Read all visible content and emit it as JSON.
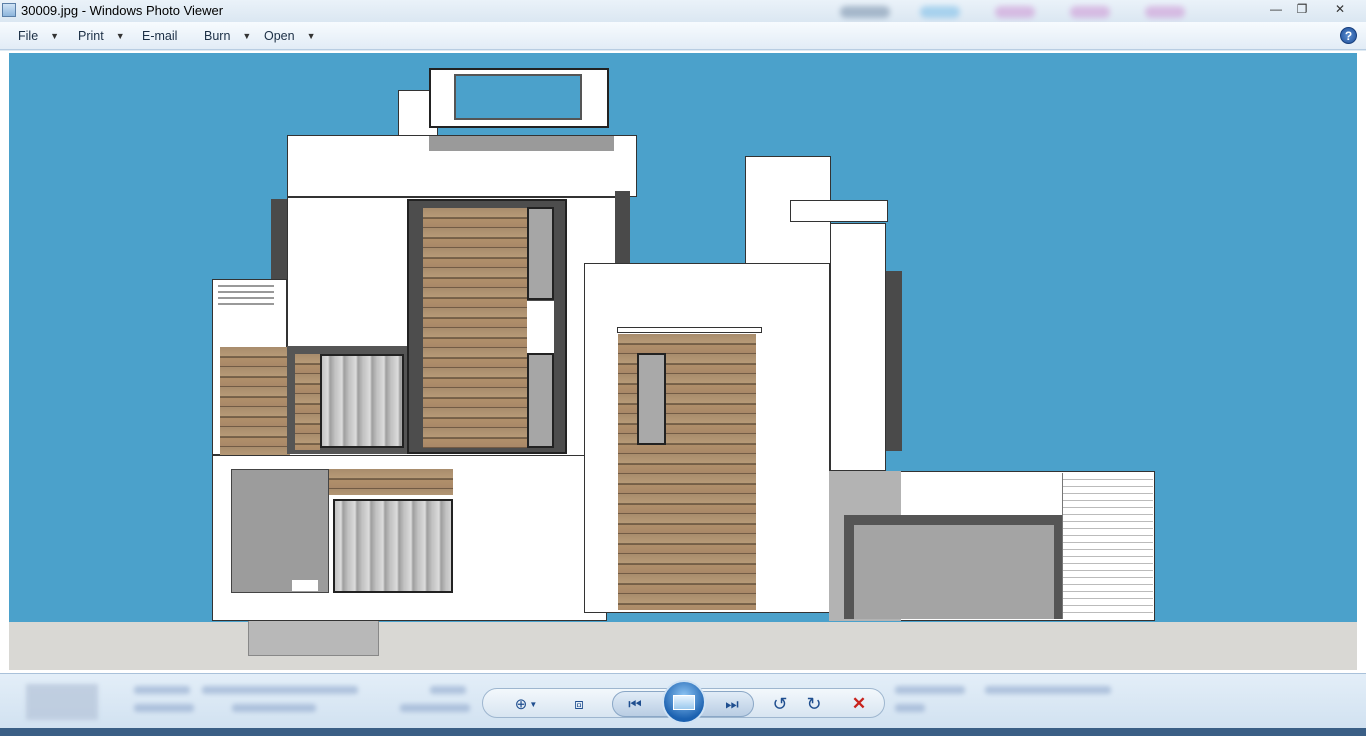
{
  "window": {
    "title": "30009.jpg - Windows Photo Viewer"
  },
  "menu": {
    "file": "File",
    "print": "Print",
    "email": "E-mail",
    "burn": "Burn",
    "open": "Open"
  },
  "icons": {
    "app": "photo-viewer-icon",
    "help": "help-icon",
    "zoom": "zoom-icon",
    "fit": "actual-size-icon",
    "previous": "previous-icon",
    "slideshow": "slideshow-icon",
    "next": "next-icon",
    "rotate_ccw": "rotate-counterclockwise-icon",
    "rotate_cw": "rotate-clockwise-icon",
    "delete": "delete-icon"
  },
  "glyphs": {
    "min": "—",
    "max": "❐",
    "close": "✕",
    "help": "?",
    "caret": "▼",
    "zoom": "⊕",
    "fit": "⧈",
    "prev": "⏮",
    "next": "⏭",
    "rot_ccw": "↺",
    "rot_cw": "↻",
    "del": "✕"
  },
  "colors": {
    "sky": "#4ba1cb",
    "ground": "#d9d8d4",
    "wood": "#a88c6c"
  }
}
